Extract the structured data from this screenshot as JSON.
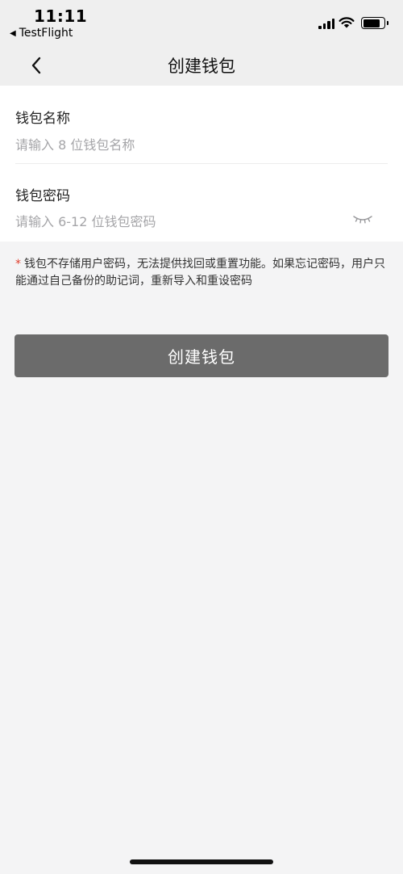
{
  "status_bar": {
    "time": "11:11",
    "back_app_label": "TestFlight"
  },
  "nav": {
    "title": "创建钱包"
  },
  "form": {
    "name_label": "钱包名称",
    "name_placeholder": "请输入 8 位钱包名称",
    "password_label": "钱包密码",
    "password_placeholder": "请输入 6-12 位钱包密码"
  },
  "notice": {
    "marker": "*",
    "text": "钱包不存储用户密码，无法提供找回或重置功能。如果忘记密码，用户只能通过自己备份的助记词，重新导入和重设密码"
  },
  "create_button_label": "创建钱包",
  "icons": {
    "back": "chevron-left-icon",
    "password_toggle": "eye-closed-icon",
    "signal": "signal-icon",
    "wifi": "wifi-icon",
    "battery": "battery-icon"
  }
}
